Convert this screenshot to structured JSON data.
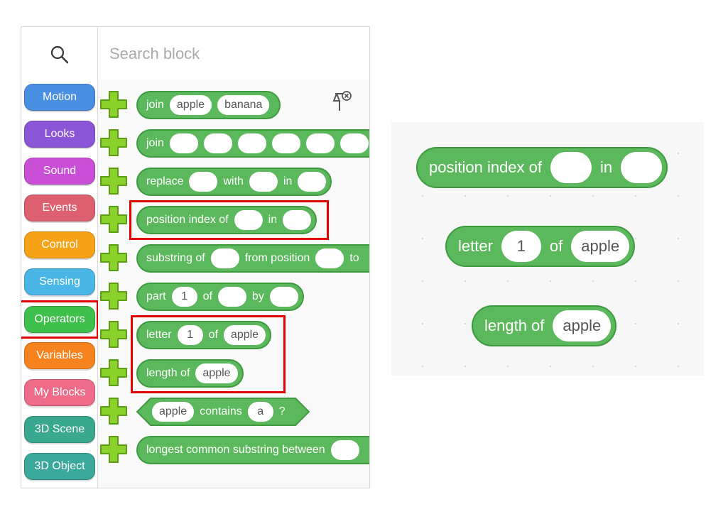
{
  "search": {
    "placeholder": "Search block"
  },
  "categories": [
    {
      "label": "Motion",
      "color": "#4a90e2"
    },
    {
      "label": "Looks",
      "color": "#8a55d7"
    },
    {
      "label": "Sound",
      "color": "#c94fd6"
    },
    {
      "label": "Events",
      "color": "#dd6070"
    },
    {
      "label": "Control",
      "color": "#f7a318"
    },
    {
      "label": "Sensing",
      "color": "#4ab6e6"
    },
    {
      "label": "Operators",
      "color": "#3fbf4c"
    },
    {
      "label": "Variables",
      "color": "#f5841f"
    },
    {
      "label": "My Blocks",
      "color": "#ef6b8a"
    },
    {
      "label": "3D Scene",
      "color": "#3aa88e"
    },
    {
      "label": "3D Object",
      "color": "#3aa89a"
    }
  ],
  "selected_category": "Operators",
  "blocks": {
    "join1": {
      "text": "join",
      "a": "apple",
      "b": "banana"
    },
    "join2": {
      "text": "join"
    },
    "replace": {
      "t1": "replace",
      "t2": "with",
      "t3": "in"
    },
    "position_index": {
      "t1": "position index of",
      "t2": "in"
    },
    "substring": {
      "t1": "substring of",
      "t2": "from position",
      "t3": "to"
    },
    "part": {
      "t1": "part",
      "v1": "1",
      "t2": "of",
      "t3": "by"
    },
    "letter": {
      "t1": "letter",
      "v1": "1",
      "t2": "of",
      "v2": "apple"
    },
    "length": {
      "t1": "length of",
      "v1": "apple"
    },
    "contains": {
      "v1": "apple",
      "t1": "contains",
      "v2": "a",
      "t2": "?"
    },
    "lcs": {
      "t1": "longest common substring between"
    }
  },
  "zoom": {
    "position_index": {
      "t1": "position index of",
      "t2": "in"
    },
    "letter": {
      "t1": "letter",
      "v1": "1",
      "t2": "of",
      "v2": "apple"
    },
    "length": {
      "t1": "length of",
      "v1": "apple"
    }
  }
}
